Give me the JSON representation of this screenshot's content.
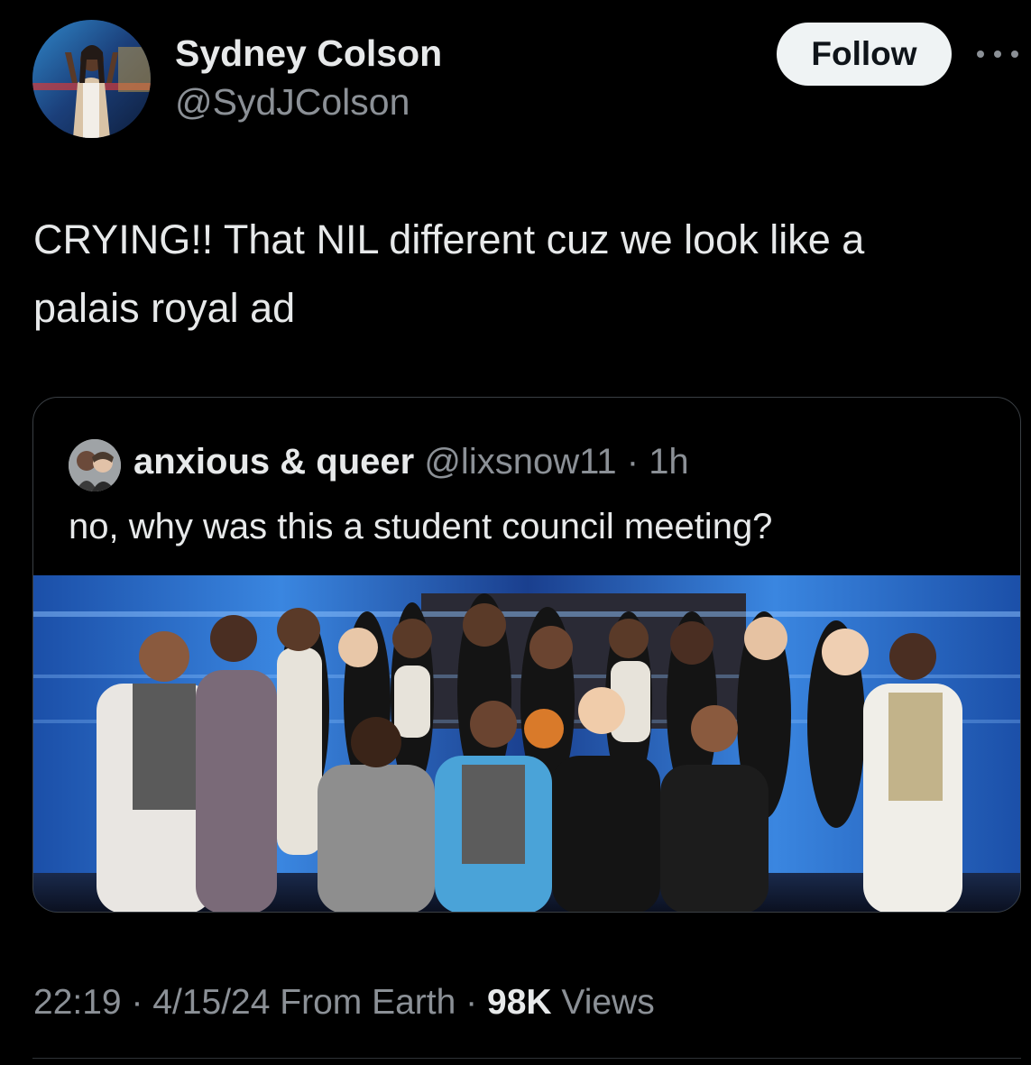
{
  "author": {
    "name": "Sydney Colson",
    "handle": "@SydJColson"
  },
  "follow_label": "Follow",
  "tweet": {
    "line1": "CRYING!! That NIL different cuz we look like a",
    "line2": "palais royal ad"
  },
  "quoted": {
    "name": "anxious & queer",
    "handle": "@lixsnow11",
    "separator": "·",
    "time": "1h",
    "text": "no, why was this a student council meeting?"
  },
  "meta": {
    "time": "22:19",
    "sep1": "·",
    "date": "4/15/24",
    "source": "From Earth",
    "sep2": "·",
    "views_count": "98K",
    "views_label": "Views"
  },
  "icons": {
    "more": "more-horizontal-icon"
  },
  "colors": {
    "background": "#000000",
    "text_primary": "#e7e9ea",
    "text_secondary": "#8b9096",
    "follow_bg": "#eff3f4",
    "border": "#3a3f44",
    "photo_studio_blue": "#1f5fc4"
  }
}
